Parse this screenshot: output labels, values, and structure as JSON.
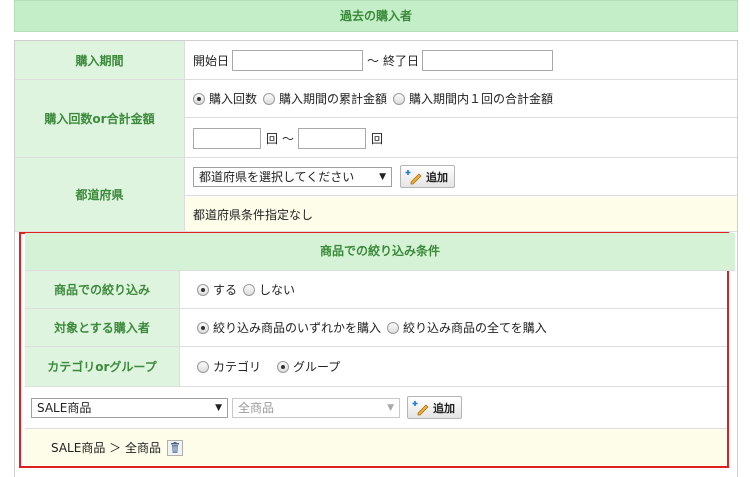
{
  "header": {
    "title": "過去の購入者"
  },
  "period": {
    "label": "購入期間",
    "start_label": "開始日",
    "separator": "～",
    "end_label": "終了日"
  },
  "count": {
    "label": "購入回数or合計金額",
    "options": [
      "購入回数",
      "購入期間の累計金額",
      "購入期間内１回の合計金額"
    ],
    "selected": 0,
    "unit_from": "回",
    "separator": "～",
    "unit_to": "回"
  },
  "prefecture": {
    "label": "都道府県",
    "select_value": "都道府県を選択してください",
    "add_button": "追加",
    "status": "都道府県条件指定なし"
  },
  "product_filter": {
    "section_title": "商品での絞り込み条件",
    "filter": {
      "label": "商品での絞り込み",
      "options": [
        "する",
        "しない"
      ],
      "selected": 0
    },
    "target": {
      "label": "対象とする購入者",
      "options": [
        "絞り込み商品のいずれかを購入",
        "絞り込み商品の全てを購入"
      ],
      "selected": 0
    },
    "category": {
      "label": "カテゴリorグループ",
      "options": [
        "カテゴリ",
        "グループ"
      ],
      "selected": 1
    },
    "select1": "SALE商品",
    "select2": "全商品",
    "add_button": "追加",
    "chosen": "SALE商品 ＞ 全商品"
  },
  "colors": {
    "label_bg": "#dff4df",
    "label_text": "#3c8a3c",
    "highlight": "#e02020"
  },
  "icons": {
    "add": "pencil-plus-icon",
    "delete": "trash-icon"
  }
}
